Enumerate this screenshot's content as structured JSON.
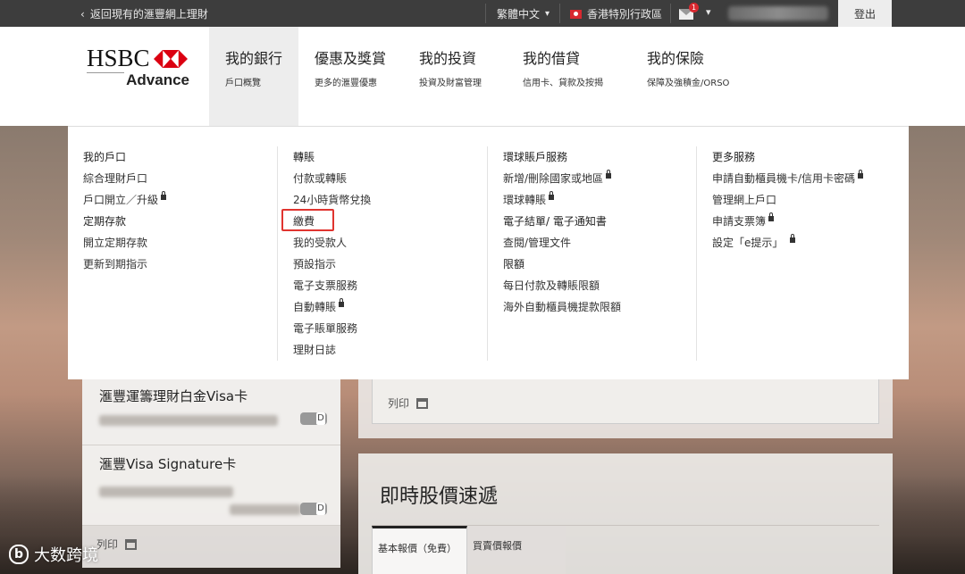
{
  "topbar": {
    "back_label": "返回現有的滙豐網上理財",
    "language": "繁體中文",
    "region": "香港特別行政區",
    "mail_count": "1",
    "logout_label": "登出"
  },
  "logo": {
    "brand": "HSBC",
    "sub": "Advance"
  },
  "nav": [
    {
      "title": "我的銀行",
      "subtitle": "戶口概覽"
    },
    {
      "title": "優惠及獎賞",
      "subtitle": "更多的滙豐優惠"
    },
    {
      "title": "我的投資",
      "subtitle": "投資及財富管理"
    },
    {
      "title": "我的借貸",
      "subtitle": "信用卡、貸款及按揭"
    },
    {
      "title": "我的保險",
      "subtitle": "保障及強積金/ORSO"
    }
  ],
  "menu": {
    "col1": {
      "items": [
        "我的戶口",
        "綜合理財戶口",
        "戶口開立／升級",
        "定期存款",
        "開立定期存款",
        "更新到期指示"
      ]
    },
    "col2": {
      "items": [
        "轉賬",
        "付款或轉賬",
        "24小時貨幣兌換",
        "繳費",
        "我的受款人",
        "預設指示",
        "電子支票服務",
        "自動轉賬",
        "電子賬單服務",
        "理財日誌"
      ]
    },
    "col3": {
      "items": [
        "環球賬戶服務",
        "新增/刪除國家或地區",
        "環球轉賬",
        "電子結單/ 電子通知書",
        "查閱/管理文件",
        "限額",
        "每日付款及轉賬限額",
        "海外自動櫃員機提款限額"
      ]
    },
    "col4": {
      "items": [
        "更多服務",
        "申請自動櫃員機卡/信用卡密碼",
        "管理網上戶口",
        "申請支票簿",
        "設定「e提示」"
      ]
    }
  },
  "cards": [
    {
      "name": "滙豐運籌理財白金Visa卡"
    },
    {
      "name": "滙豐Visa Signature卡"
    }
  ],
  "print_label": "列印",
  "stock": {
    "title": "即時股價速遞",
    "tabs": [
      "基本報價（免費）",
      "買賣價報價"
    ]
  },
  "watermark": "大数跨境"
}
